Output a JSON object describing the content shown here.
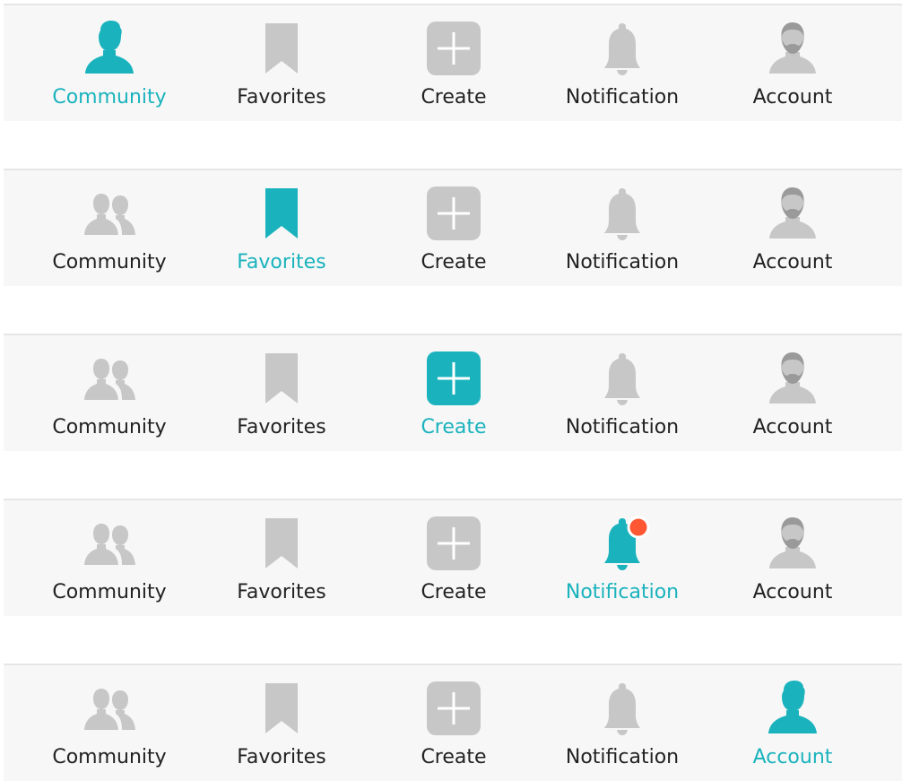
{
  "colors": {
    "accent": "#1ab3bd",
    "inactive_icon": "#c7c7c7",
    "inactive_icon_dark": "#9a9a9a",
    "label": "#222222",
    "badge": "#ff5733",
    "bar_background": "#f7f7f7"
  },
  "tab_labels": [
    "Community",
    "Favorites",
    "Create",
    "Notification",
    "Account"
  ],
  "tab_icons": [
    "people-icon",
    "bookmark-icon",
    "plus-square-icon",
    "bell-icon",
    "user-icon"
  ],
  "bars": [
    {
      "active_tab": "Community",
      "active_icon": "person-icon",
      "labels": [
        "Community",
        "Favorites",
        "Create",
        "Notification",
        "Account"
      ],
      "badge": false
    },
    {
      "active_tab": "Favorites",
      "active_icon": "bookmark-icon",
      "labels": [
        "Community",
        "Favorites",
        "Create",
        "Notification",
        "Account"
      ],
      "badge": false
    },
    {
      "active_tab": "Create",
      "active_icon": "plus-square-icon",
      "labels": [
        "Community",
        "Favorites",
        "Create",
        "Notification",
        "Account"
      ],
      "badge": false
    },
    {
      "active_tab": "Notification",
      "active_icon": "bell-icon",
      "labels": [
        "Community",
        "Favorites",
        "Create",
        "Notification",
        "Account"
      ],
      "badge": true
    },
    {
      "active_tab": "Account",
      "active_icon": "person-icon",
      "labels": [
        "Community",
        "Favorites",
        "Create",
        "Notification",
        "Account"
      ],
      "badge": false
    }
  ]
}
